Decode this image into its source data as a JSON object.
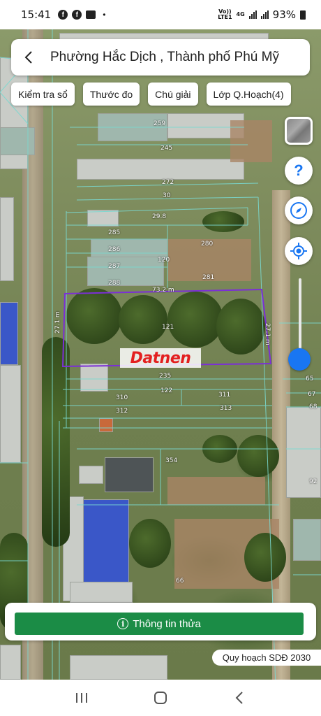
{
  "status_bar": {
    "time": "15:41",
    "notification_icons": [
      "facebook-icon",
      "facebook-icon",
      "gallery-icon"
    ],
    "network_label_top": "Vo))",
    "network_label_bottom": "LTE1",
    "network_type": "4G",
    "battery": "93%"
  },
  "header": {
    "title": "Phường Hắc Dịch , Thành phố Phú Mỹ",
    "back_icon": "chevron-left-icon"
  },
  "toolbar": {
    "check_book": "Kiểm tra sổ",
    "ruler": "Thước đo",
    "legend": "Chú giải",
    "planning_layer": "Lớp Q.Hoạch(4)"
  },
  "map": {
    "parcel_labels": [
      "259",
      "245",
      "272",
      "30",
      "29.8",
      "285",
      "280",
      "286",
      "120",
      "287",
      "281",
      "288",
      "73.2 m",
      "27.1 m",
      "27.1 m",
      "121",
      "235",
      "122",
      "310",
      "311",
      "312",
      "313",
      "354",
      "65",
      "67",
      "68",
      "92",
      "66"
    ],
    "selected_parcel_color": "#7b2fd6",
    "watermark": "Datnen"
  },
  "controls": {
    "layer_button": "satellite-layer-thumbnail",
    "help_icon": "question-icon",
    "compass_icon": "compass-icon",
    "location_icon": "my-location-icon",
    "accent": "#1976f2"
  },
  "bottom": {
    "info_button": "Thông tin thửa",
    "info_color": "#1b8c46",
    "plan_badge": "Quy hoạch SDĐ 2030"
  },
  "navbar": {
    "recent": "recent-apps-icon",
    "home": "home-icon",
    "back": "back-icon"
  }
}
